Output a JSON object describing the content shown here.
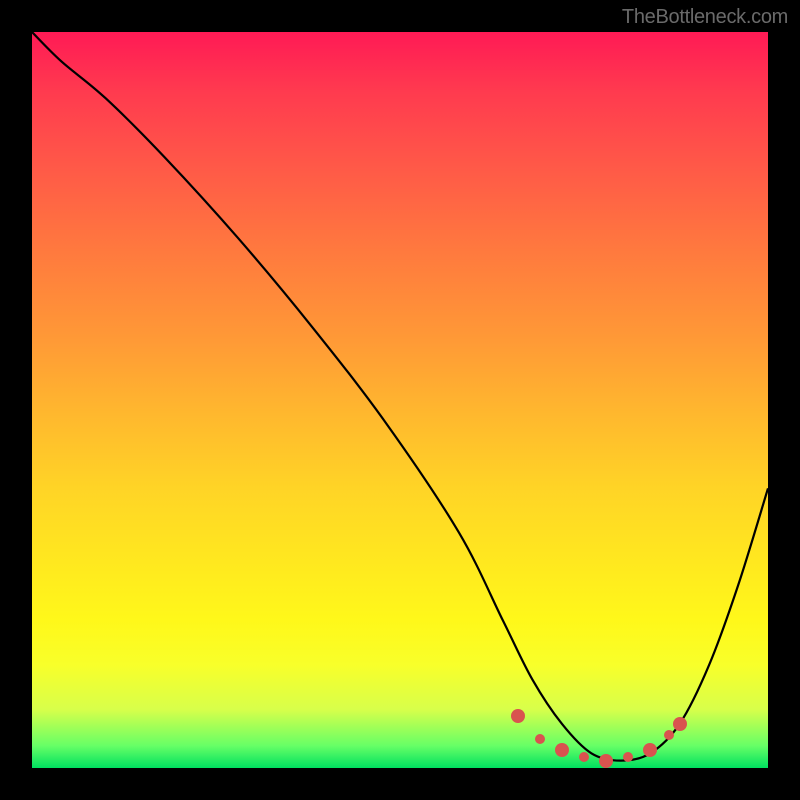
{
  "attribution": "TheBottleneck.com",
  "chart_data": {
    "type": "line",
    "title": "",
    "xlabel": "",
    "ylabel": "",
    "xlim": [
      0,
      100
    ],
    "ylim": [
      0,
      100
    ],
    "background_gradient": {
      "top_color": "#ff1a55",
      "bottom_color": "#00e060"
    },
    "series": [
      {
        "name": "bottleneck-curve",
        "x": [
          0,
          4,
          10,
          18,
          28,
          38,
          48,
          58,
          64,
          68,
          72,
          76,
          80,
          84,
          88,
          92,
          96,
          100
        ],
        "y": [
          100,
          96,
          91,
          83,
          72,
          60,
          47,
          32,
          20,
          12,
          6,
          2,
          1,
          2,
          6,
          14,
          25,
          38
        ]
      }
    ],
    "markers": {
      "name": "optimal-range",
      "color": "#d9534f",
      "points": [
        {
          "x": 66,
          "y": 7
        },
        {
          "x": 69,
          "y": 4
        },
        {
          "x": 72,
          "y": 2.5
        },
        {
          "x": 75,
          "y": 1.5
        },
        {
          "x": 78,
          "y": 1
        },
        {
          "x": 81,
          "y": 1.5
        },
        {
          "x": 84,
          "y": 2.5
        },
        {
          "x": 86.5,
          "y": 4.5
        },
        {
          "x": 88,
          "y": 6
        }
      ]
    }
  }
}
